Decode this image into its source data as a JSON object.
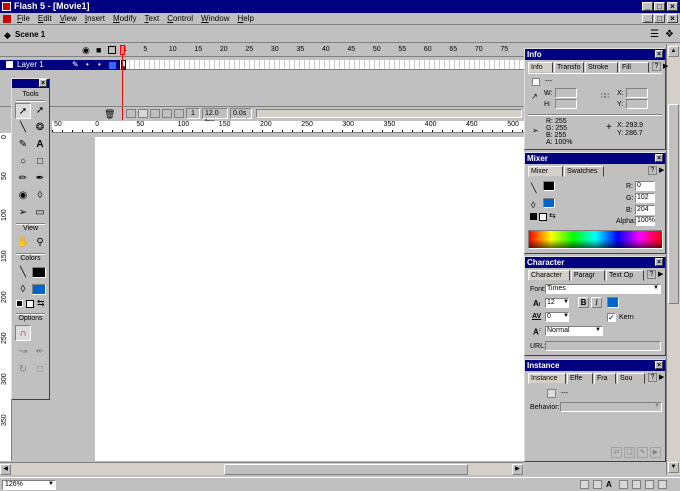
{
  "app": {
    "title": "Flash 5 - [Movie1]",
    "accent": "#000080",
    "window_controls": [
      "_",
      "□",
      "×"
    ],
    "doc_controls": [
      "_",
      "□",
      "×"
    ]
  },
  "menu": [
    "File",
    "Edit",
    "View",
    "Insert",
    "Modify",
    "Text",
    "Control",
    "Window",
    "Help"
  ],
  "scene": {
    "label": "Scene 1"
  },
  "timeline": {
    "frame_numbers": [
      "1",
      "5",
      "10",
      "15",
      "20",
      "25",
      "30",
      "35",
      "40",
      "45",
      "50",
      "55",
      "60",
      "65",
      "70",
      "75"
    ],
    "layer_name": "Layer 1",
    "current_frame": "1",
    "fps": "12.0 fps",
    "time": "0.0s"
  },
  "ruler": {
    "h_ticks": [
      "50",
      "0",
      "50",
      "100",
      "150",
      "200",
      "250",
      "300",
      "350",
      "400",
      "450",
      "500"
    ],
    "v_ticks": [
      "0",
      "50",
      "100",
      "150",
      "200",
      "250",
      "300",
      "350"
    ]
  },
  "tools": {
    "title": "Tools",
    "sections": {
      "view": "View",
      "colors": "Colors",
      "options": "Options"
    },
    "stroke_color": "#000000",
    "fill_color": "#0066cc"
  },
  "info": {
    "title": "Info",
    "tabs": [
      "Info",
      "Transfo",
      "Stroke",
      "Fill"
    ],
    "name": "---",
    "w_label": "W:",
    "h_label": "H:",
    "x_label": "X:",
    "y_label": "Y:",
    "r": "R: 255",
    "g": "G: 255",
    "b": "B: 255",
    "a": "A: 100%",
    "cursor_x": "X:  293.9",
    "cursor_y": "Y:  286.7"
  },
  "mixer": {
    "title": "Mixer",
    "tabs": [
      "Mixer",
      "Swatches"
    ],
    "r_label": "R:",
    "r_value": "0",
    "g_label": "G:",
    "g_value": "102",
    "b_label": "B:",
    "b_value": "204",
    "alpha_label": "Alpha:",
    "alpha_value": "100%"
  },
  "character": {
    "title": "Character",
    "tabs": [
      "Character",
      "Paragr",
      "Text Op"
    ],
    "font_label": "Font:",
    "font_value": "Times",
    "size_value": "12",
    "bold": "B",
    "italic": "I",
    "tracking_value": "0",
    "kern_label": "Kern",
    "baseline_value": "Normal",
    "url_label": "URL:",
    "text_color": "#0066cc"
  },
  "instance": {
    "title": "Instance",
    "tabs": [
      "Instance",
      "Effe",
      "Fra",
      "Sou"
    ],
    "name": "---",
    "behavior_label": "Behavior:"
  },
  "status": {
    "zoom": "126%"
  }
}
